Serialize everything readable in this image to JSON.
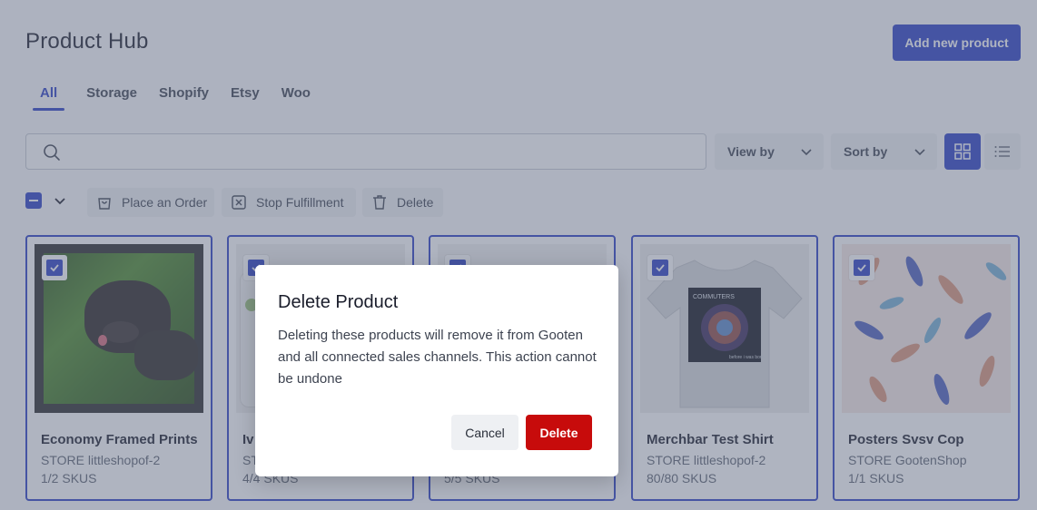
{
  "header": {
    "title": "Product Hub",
    "add_button": "Add new product"
  },
  "tabs": [
    {
      "label": "All",
      "active": true
    },
    {
      "label": "Storage",
      "active": false
    },
    {
      "label": "Shopify",
      "active": false
    },
    {
      "label": "Etsy",
      "active": false
    },
    {
      "label": "Woo",
      "active": false
    }
  ],
  "toolbar": {
    "search_value": "",
    "view_by": "View by",
    "sort_by": "Sort by",
    "layout": "grid"
  },
  "bulk_actions": {
    "place_order": "Place an Order",
    "stop_fulfillment": "Stop Fulfillment",
    "delete": "Delete"
  },
  "products": [
    {
      "name": "Economy Framed Prints",
      "store": "STORE littleshopof-2",
      "skus": "1/2 SKUS",
      "checked": true
    },
    {
      "name": "Iv",
      "store": "ST",
      "skus": "4/4 SKUS",
      "checked": true
    },
    {
      "name": "",
      "store": "",
      "skus": "5/5 SKUS",
      "checked": true
    },
    {
      "name": "Merchbar Test Shirt",
      "store": "STORE littleshopof-2",
      "skus": "80/80 SKUS",
      "checked": true
    },
    {
      "name": "Posters Svsv Cop",
      "store": "STORE GootenShop",
      "skus": "1/1 SKUS",
      "checked": true
    }
  ],
  "modal": {
    "title": "Delete Product",
    "body": "Deleting these products will remove it from Gooten and all connected sales channels. This action cannot be undone",
    "cancel": "Cancel",
    "confirm": "Delete"
  },
  "colors": {
    "accent": "#2b3fc4",
    "danger": "#c70b0b",
    "overlay": "rgba(96,106,130,0.5)"
  },
  "shirt_print": {
    "band": "COMMUTERS",
    "caption": "before i was born"
  }
}
